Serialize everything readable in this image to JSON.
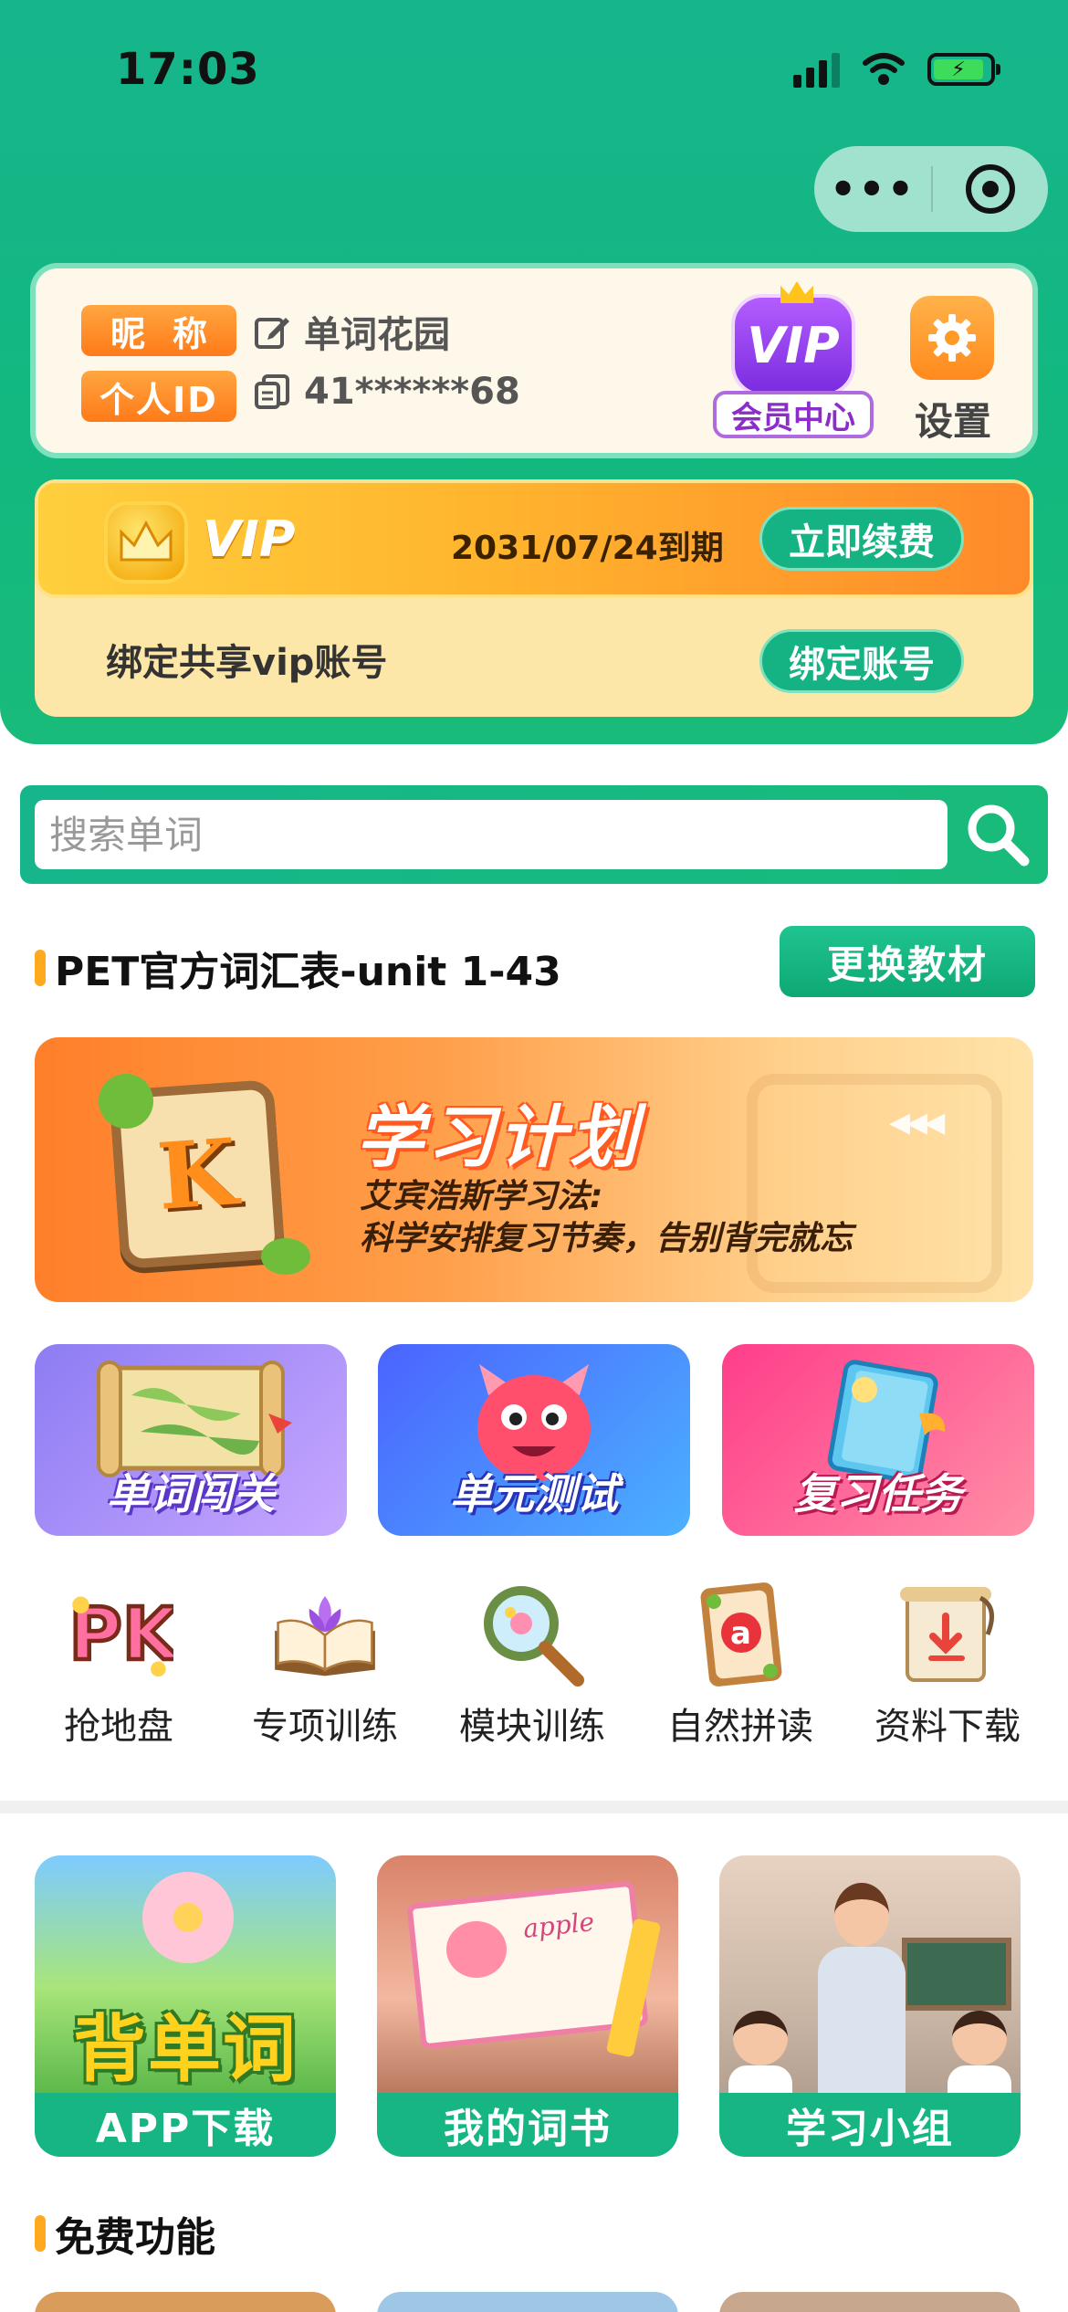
{
  "status_bar": {
    "time": "17:03"
  },
  "capsule": {
    "more_label": "•••"
  },
  "profile": {
    "nickname_tag": "昵称",
    "nickname": "单词花园",
    "id_tag": "个人ID",
    "id_value": "41******68",
    "vip_badge": "VIP",
    "vip_center_label": "会员中心",
    "settings_label": "设置"
  },
  "vip": {
    "badge_text": "VIP",
    "expiry": "2031/07/24到期",
    "renew_label": "立即续费",
    "bind_text": "绑定共享vip账号",
    "bind_label": "绑定账号"
  },
  "search": {
    "placeholder": "搜索单词"
  },
  "textbook": {
    "title": "PET官方词汇表-unit 1-43",
    "change_label": "更换教材"
  },
  "plan": {
    "card_letter": "K",
    "title": "学习计划",
    "subtitle_line1": "艾宾浩斯学习法:",
    "subtitle_line2": "科学安排复习节奏，告别背完就忘"
  },
  "features": [
    {
      "label": "单词闯关"
    },
    {
      "label": "单元测试"
    },
    {
      "label": "复习任务"
    }
  ],
  "tools": [
    {
      "label": "抢地盘",
      "icon_text": "PK"
    },
    {
      "label": "专项训练"
    },
    {
      "label": "模块训练"
    },
    {
      "label": "自然拼读",
      "icon_text": "a"
    },
    {
      "label": "资料下载"
    }
  ],
  "cards": [
    {
      "label": "APP下载",
      "art_text": "背单词"
    },
    {
      "label": "我的词书",
      "art_text": "apple"
    },
    {
      "label": "学习小组"
    }
  ],
  "free_section": {
    "title": "免费功能"
  },
  "colors": {
    "brand_green": "#16b583",
    "accent_orange": "#ffa91f"
  }
}
